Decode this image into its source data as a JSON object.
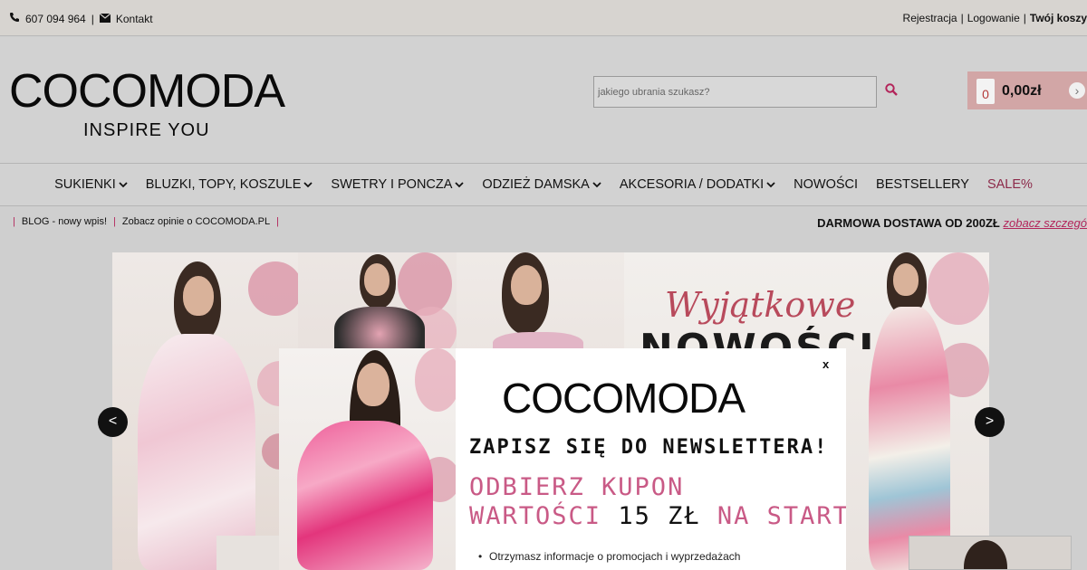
{
  "topbar": {
    "phone_icon": "phone-icon",
    "phone": "607 094 964",
    "sep": "|",
    "mail_icon": "envelope-icon",
    "contact": "Kontakt",
    "register": "Rejestracja",
    "login": "Logowanie",
    "cart_label": "Twój koszy"
  },
  "header": {
    "logo": "COCOMODA",
    "tagline": "INSPIRE YOU",
    "search_placeholder": "jakiego ubrania szukasz?",
    "search_icon": "search-icon",
    "cart_count": "0",
    "cart_total": "0,00zł",
    "cart_arrow": "›"
  },
  "nav": {
    "items": [
      {
        "label": "SUKIENKI",
        "chevron": true
      },
      {
        "label": "BLUZKI, TOPY, KOSZULE",
        "chevron": true
      },
      {
        "label": "SWETRY I PONCZA",
        "chevron": true
      },
      {
        "label": "ODZIEŻ DAMSKA",
        "chevron": true
      },
      {
        "label": "AKCESORIA / DODATKI",
        "chevron": true
      },
      {
        "label": "NOWOŚCI",
        "chevron": false
      },
      {
        "label": "BESTSELLERY",
        "chevron": false
      },
      {
        "label": "SALE%",
        "chevron": false
      }
    ]
  },
  "infobar": {
    "blog": "BLOG - nowy wpis!",
    "reviews": "Zobacz opinie o COCOMODA.PL",
    "shipping": "DARMOWA DOSTAWA OD 200ZŁ",
    "details_link": "zobacz szczegó"
  },
  "banner": {
    "title": "Wyjątkowe",
    "big": "NOWOŚCI",
    "prev": "<",
    "next": ">"
  },
  "popup": {
    "close": "x",
    "logo": "COCOMODA",
    "headline": "ZAPISZ SIĘ DO NEWSLETTERA!",
    "line1": "ODBIERZ KUPON",
    "line2_a": "WARTOŚCI",
    "line2_b": "15 ZŁ",
    "line2_c": "NA START!",
    "bullet1": "Otrzymasz informacje o promocjach i wyprzedażach"
  },
  "colors": {
    "accent": "#c95a86",
    "sale": "#8c2a4a",
    "cart_bg": "#d2a6a6"
  }
}
